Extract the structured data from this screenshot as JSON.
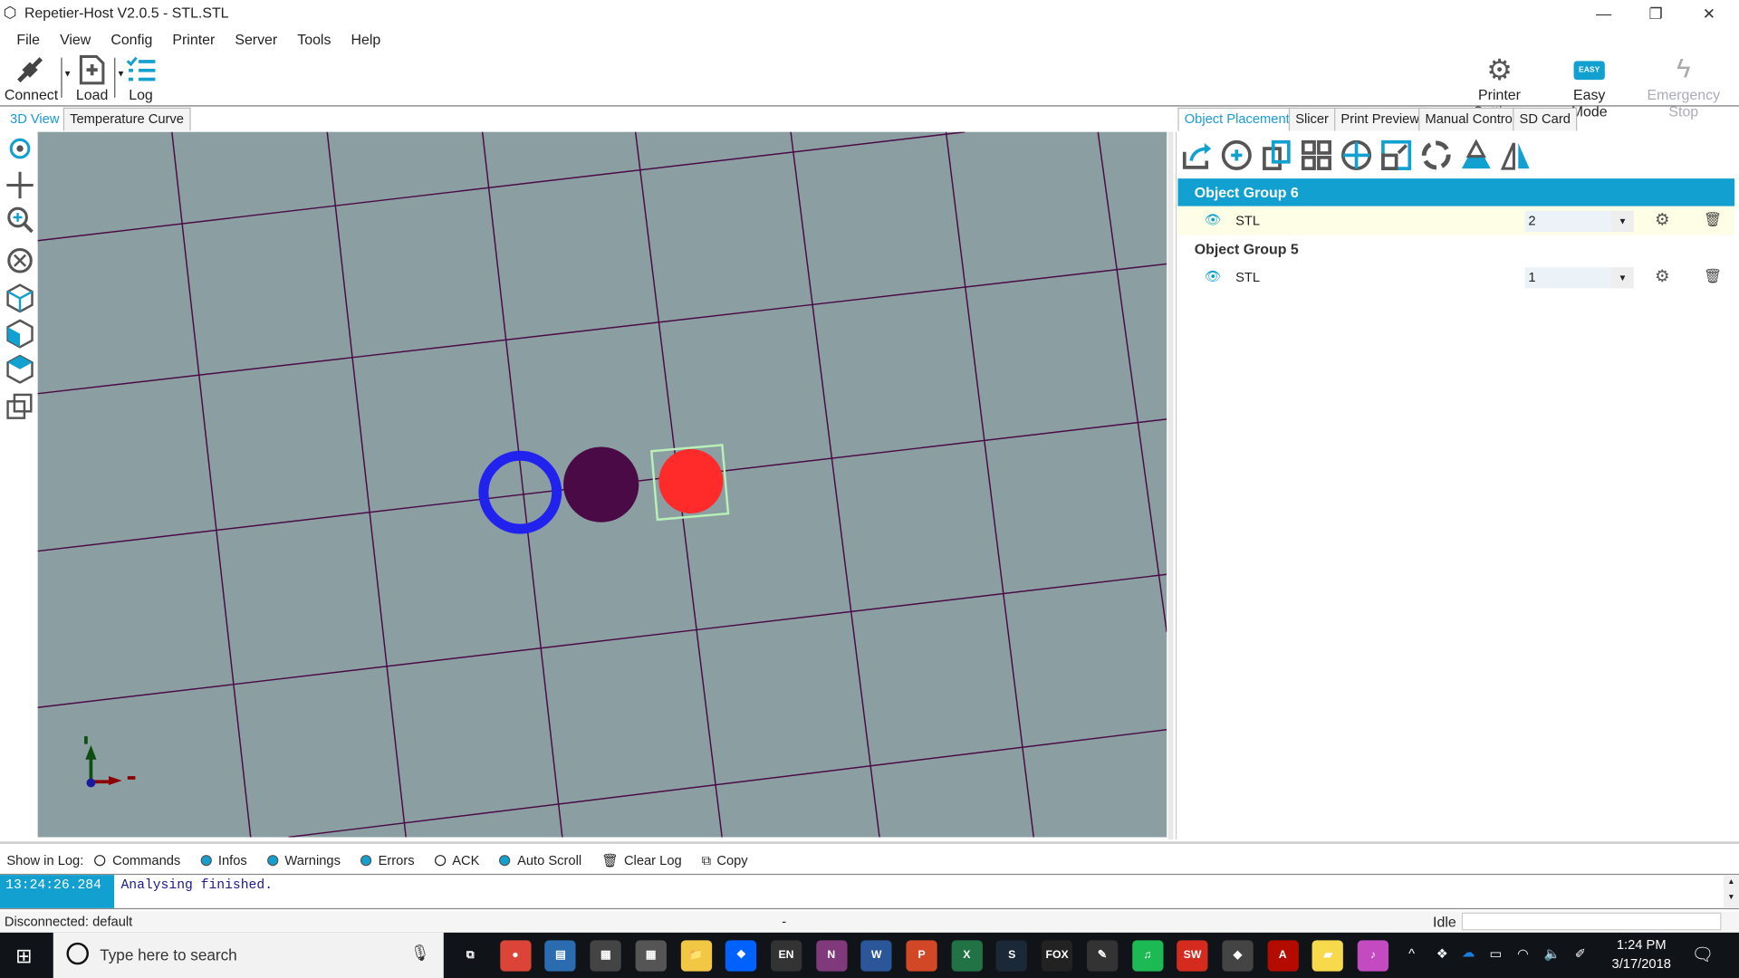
{
  "window": {
    "title": "Repetier-Host V2.0.5 - STL.STL",
    "minimize": "—",
    "restore": "❐",
    "close": "✕"
  },
  "menu": [
    "File",
    "View",
    "Config",
    "Printer",
    "Server",
    "Tools",
    "Help"
  ],
  "toolbar": {
    "connect": "Connect",
    "load": "Load",
    "log": "Log",
    "printer_settings": "Printer Settings",
    "easy_badge": "EASY",
    "easy_mode": "Easy Mode",
    "emergency_stop": "Emergency Stop"
  },
  "left_tabs": [
    "3D View",
    "Temperature Curve"
  ],
  "right_tabs": [
    "Object Placement",
    "Slicer",
    "Print Preview",
    "Manual Control",
    "SD Card"
  ],
  "objects": [
    {
      "group": "Object Group 6",
      "name": "STL",
      "copies": "2",
      "selected": true
    },
    {
      "group": "Object Group 5",
      "name": "STL",
      "copies": "1",
      "selected": false
    }
  ],
  "scene": {
    "objects": [
      {
        "shape": "ring",
        "color": "#2222ee"
      },
      {
        "shape": "disc",
        "color": "#4a0a45"
      },
      {
        "shape": "disc",
        "color": "#ff2a2a",
        "selected": true
      }
    ],
    "grid_color": "#4a0a45",
    "background": "#8b9fa3"
  },
  "log": {
    "show_in_log": "Show in Log:",
    "options": [
      {
        "label": "Commands",
        "on": false
      },
      {
        "label": "Infos",
        "on": true
      },
      {
        "label": "Warnings",
        "on": true
      },
      {
        "label": "Errors",
        "on": true
      },
      {
        "label": "ACK",
        "on": false
      },
      {
        "label": "Auto Scroll",
        "on": true
      }
    ],
    "clear": "Clear Log",
    "copy": "Copy",
    "entries": [
      {
        "time": "13:24:26.284",
        "text": "Analysing finished."
      }
    ]
  },
  "status": {
    "connection": "Disconnected: default",
    "middle": "-",
    "state": "Idle"
  },
  "taskbar": {
    "search_placeholder": "Type here to search",
    "time": "1:24 PM",
    "date": "3/17/2018",
    "apps": [
      {
        "name": "task-view",
        "label": "⧉",
        "color": "#101418"
      },
      {
        "name": "chrome",
        "label": "●",
        "color": "#db4437"
      },
      {
        "name": "app",
        "label": "▤",
        "color": "#2b6cb0"
      },
      {
        "name": "calendar",
        "label": "▦",
        "color": "#444"
      },
      {
        "name": "calculator",
        "label": "▦",
        "color": "#555"
      },
      {
        "name": "file-explorer",
        "label": "📁",
        "color": "#f2c744"
      },
      {
        "name": "dropbox",
        "label": "❖",
        "color": "#0061fe"
      },
      {
        "name": "language",
        "label": "EN",
        "color": "#333"
      },
      {
        "name": "onenote",
        "label": "N",
        "color": "#80397b"
      },
      {
        "name": "word",
        "label": "W",
        "color": "#2b579a"
      },
      {
        "name": "powerpoint",
        "label": "P",
        "color": "#d24726"
      },
      {
        "name": "excel",
        "label": "X",
        "color": "#217346"
      },
      {
        "name": "steam",
        "label": "S",
        "color": "#1b2838"
      },
      {
        "name": "fox-sports-go",
        "label": "FOX",
        "color": "#222"
      },
      {
        "name": "pencil",
        "label": "✎",
        "color": "#333"
      },
      {
        "name": "spotify",
        "label": "♫",
        "color": "#1db954"
      },
      {
        "name": "solidworks",
        "label": "SW",
        "color": "#d52b1e"
      },
      {
        "name": "repetier",
        "label": "◆",
        "color": "#444"
      },
      {
        "name": "acrobat",
        "label": "A",
        "color": "#b30b00"
      },
      {
        "name": "sticky-notes",
        "label": "▰",
        "color": "#f7d94c"
      },
      {
        "name": "itunes",
        "label": "♪",
        "color": "#c34ac1"
      }
    ]
  }
}
